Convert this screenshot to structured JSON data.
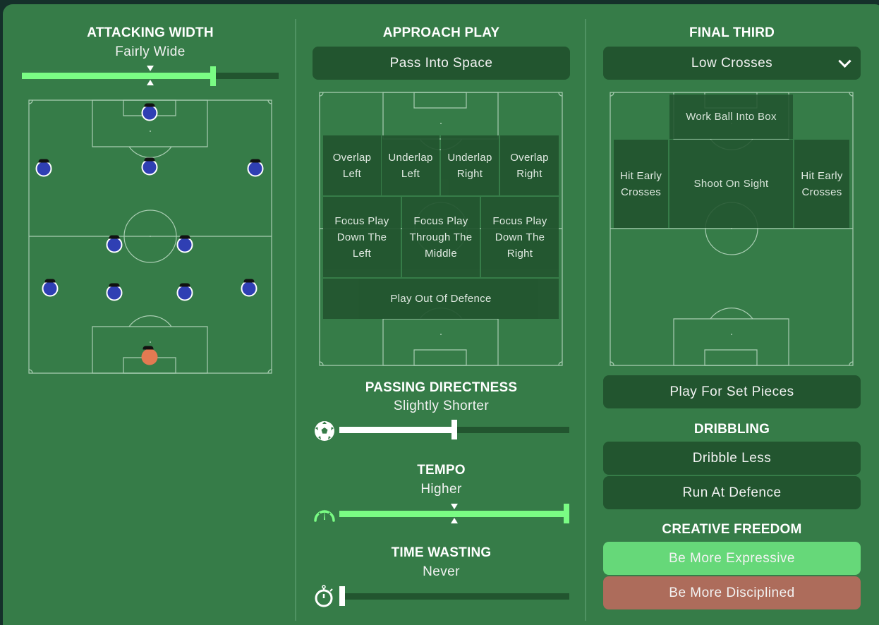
{
  "attacking_width": {
    "title": "ATTACKING WIDTH",
    "value": "Fairly Wide",
    "slider_fraction": 0.75,
    "default_marker_fraction": 0.5
  },
  "formation": {
    "players": [
      {
        "role": "striker",
        "team": "outfield"
      },
      {
        "role": "attacking-midfielder-left",
        "team": "outfield"
      },
      {
        "role": "attacking-midfielder-centre",
        "team": "outfield"
      },
      {
        "role": "attacking-midfielder-right",
        "team": "outfield"
      },
      {
        "role": "central-midfielder-left",
        "team": "outfield"
      },
      {
        "role": "central-midfielder-right",
        "team": "outfield"
      },
      {
        "role": "left-back",
        "team": "outfield"
      },
      {
        "role": "centre-back-left",
        "team": "outfield"
      },
      {
        "role": "centre-back-right",
        "team": "outfield"
      },
      {
        "role": "right-back",
        "team": "outfield"
      },
      {
        "role": "goalkeeper",
        "team": "goalkeeper"
      }
    ]
  },
  "approach_play": {
    "title": "APPROACH PLAY",
    "selected": "Pass Into Space",
    "zones": {
      "overlap_left": "Overlap Left",
      "underlap_left": "Underlap Left",
      "underlap_right": "Underlap Right",
      "overlap_right": "Overlap Right",
      "focus_left": "Focus Play Down The Left",
      "focus_middle": "Focus Play Through The Middle",
      "focus_right": "Focus Play Down The Right",
      "play_out": "Play Out Of Defence"
    }
  },
  "passing_directness": {
    "title": "PASSING DIRECTNESS",
    "value": "Slightly Shorter",
    "slider_fraction": 0.5,
    "icon": "football-icon"
  },
  "tempo": {
    "title": "TEMPO",
    "value": "Higher",
    "slider_fraction": 1.0,
    "default_marker_fraction": 0.5,
    "icon": "speedometer-icon"
  },
  "time_wasting": {
    "title": "TIME WASTING",
    "value": "Never",
    "slider_fraction": 0.0,
    "icon": "stopwatch-icon"
  },
  "final_third": {
    "title": "FINAL THIRD",
    "selected": "Low Crosses",
    "zones": {
      "work_ball": "Work Ball Into Box",
      "hit_early_left": "Hit Early Crosses",
      "shoot_on_sight": "Shoot On Sight",
      "hit_early_right": "Hit Early Crosses"
    },
    "set_pieces": "Play For Set Pieces"
  },
  "dribbling": {
    "title": "DRIBBLING",
    "options": [
      "Dribble Less",
      "Run At Defence"
    ]
  },
  "creative_freedom": {
    "title": "CREATIVE FREEDOM",
    "options": [
      {
        "label": "Be More Expressive",
        "color": "#66d879",
        "state": "selected"
      },
      {
        "label": "Be More Disciplined",
        "color": "#ad6c5b",
        "state": "negative"
      }
    ]
  },
  "colors": {
    "background": "#15302a",
    "panel": "#367c48",
    "box": "#22552f",
    "slider_fill_green": "#7afc84",
    "slider_fill_white": "#ffffff",
    "player_blue": "#2f3fb3",
    "goalkeeper_orange": "#e37a52"
  }
}
